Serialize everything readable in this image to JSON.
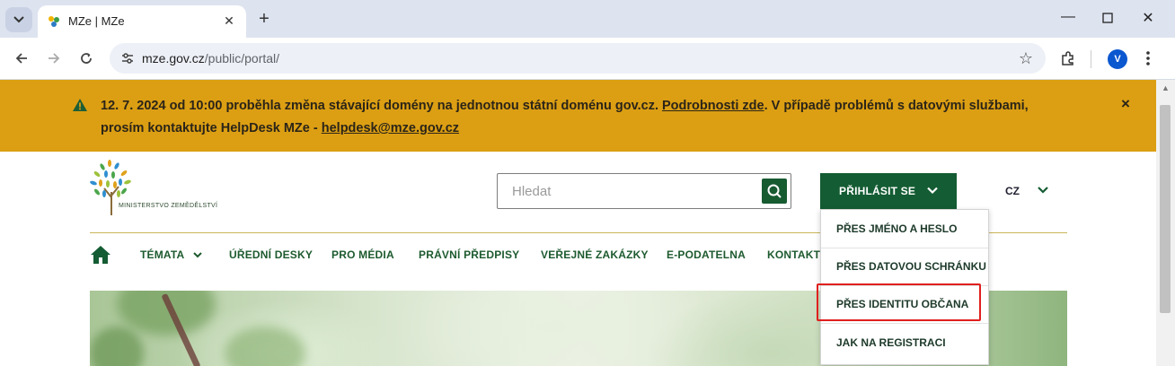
{
  "browser": {
    "tab_title": "MZe | MZe",
    "url_host": "mze.gov.cz",
    "url_path": "/public/portal/",
    "profile_initial": "V"
  },
  "icons": {
    "tab_dropdown": "chevron-down-icon",
    "tab_favicon": "mze-leaf-favicon",
    "tab_close": "close-icon",
    "new_tab": "plus-icon",
    "minimize": "minimize-icon",
    "maximize": "maximize-icon",
    "window_close": "close-icon",
    "back": "arrow-left-icon",
    "forward": "arrow-right-icon",
    "reload": "reload-icon",
    "site_settings": "tune-icon",
    "bookmark": "star-icon",
    "extensions": "puzzle-icon",
    "menu": "kebab-menu-icon",
    "warning": "warning-icon",
    "search": "search-icon",
    "home": "home-icon"
  },
  "banner": {
    "text_1": "12. 7. 2024 od 10:00 proběhla změna stávající domény na jednotnou státní doménu gov.cz. ",
    "link_details": "Podrobnosti zde",
    "text_2": ". V případě problémů s datovými službami,",
    "text_3": "prosím kontaktujte HelpDesk MZe - ",
    "link_email": "helpdesk@mze.gov.cz",
    "close": "×",
    "color": "#dc9f13"
  },
  "header": {
    "logo_text": "MINISTERSTVO ZEMĚDĚLSTVÍ",
    "search_placeholder": "Hledat",
    "login_label": "PŘIHLÁSIT SE",
    "language": "CZ",
    "brand_green": "#145c33"
  },
  "nav": {
    "items": [
      {
        "label": "TÉMATA",
        "has_dropdown": true
      },
      {
        "label": "ÚŘEDNÍ DESKY"
      },
      {
        "label": "PRO MÉDIA"
      },
      {
        "label": "PRÁVNÍ PŘEDPISY"
      },
      {
        "label": "VEŘEJNÉ ZAKÁZKY"
      },
      {
        "label": "E-PODATELNA"
      },
      {
        "label": "KONTAKTY"
      }
    ]
  },
  "login_menu": {
    "items": [
      {
        "label": "PŘES JMÉNO A HESLO"
      },
      {
        "label": "PŘES DATOVOU SCHRÁNKU"
      },
      {
        "label": "PŘES IDENTITU OBČANA",
        "highlighted": true
      },
      {
        "label": "JAK NA REGISTRACI"
      }
    ],
    "highlight_color": "#e0201e"
  }
}
